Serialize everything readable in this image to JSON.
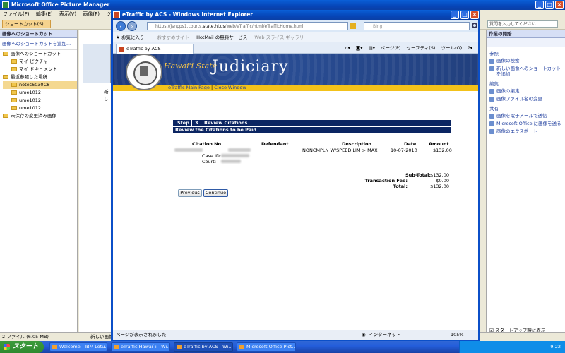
{
  "pm": {
    "title": "Microsoft Office Picture Manager",
    "menu": [
      "ファイル(F)",
      "編集(E)",
      "表示(V)",
      "画像(P)",
      "ツール("
    ],
    "toolbar_shortcut": "ショートカット(S)...",
    "help_placeholder": "質問を入力してください",
    "left_header": "画像へのショートカット",
    "add_shortcut": "画像へのショートカットを追加...",
    "tree": [
      "画像へのショートカット",
      "マイ ピクチャ",
      "マイ ドキュメント",
      "最近参照した場所",
      "notes6030C8",
      "ume1012",
      "ume1012",
      "ume1012",
      "未保存の変更済み画像"
    ],
    "status_left": "2 ファイル (6.05 MB)",
    "status_mid": "新しい画像",
    "thumb_label": "新し",
    "right_header": "作業の開始",
    "sections": {
      "browse": "参照",
      "edit": "編集",
      "share": "共有"
    },
    "links": {
      "find": "画像の検索",
      "new_shortcut": "新しい画像へのショートカットを追加",
      "edit_pictures": "画像の編集",
      "rename": "画像ファイル名の変更",
      "email": "画像を電子メールで送信",
      "send_office": "Microsoft Office に画像を送る",
      "export": "画像のエクスポート"
    },
    "startup_checkbox": "スタートアップ時に表示"
  },
  "ie": {
    "title": "eTraffic by ACS - Windows Internet Explorer",
    "url_prefix": "https://jsnpps1.courts.",
    "url_host": "state.hi.us",
    "url_suffix": "/web/eTraffic/html/eTrafficHome.html",
    "search_placeholder": "Bing",
    "favorites": "お気に入り",
    "fav1": "おすすめサイト",
    "fav2": "HotMail の無料サービス",
    "fav3": "Web スライス ギャラリー",
    "tab": "eTraffic by ACS",
    "tools": [
      "ページ(P)",
      "セーフティ(S)",
      "ツール(O)"
    ],
    "status": "ページが表示されました",
    "zone": "インターネット",
    "zoom": "105%"
  },
  "site": {
    "state": "Hawai'i State",
    "judiciary": "Judiciary",
    "nav_main": "eTraffic Main Page",
    "nav_sep": "|",
    "nav_close": "Close Window",
    "step_label": "Step",
    "step_num": "3",
    "step_title": "Review Citations",
    "review_bar": "Review the Citations to be Paid",
    "cols": {
      "citation": "Citation No",
      "defendant": "Defendant",
      "description": "Description",
      "date": "Date",
      "amount": "Amount"
    },
    "row": {
      "description": "NONCMPLN W/SPEED LIM > MAX",
      "date": "10-07-2010",
      "amount": "$132.00",
      "case_label": "Case ID:",
      "court_label": "Court:"
    },
    "totals": {
      "subtotal_label": "Sub-Total:",
      "subtotal": "$132.00",
      "fee_label": "Transaction Fee:",
      "fee": "$0.00",
      "total_label": "Total:",
      "total": "$132.00"
    },
    "previous": "Previous",
    "continue": "Continue"
  },
  "taskbar": {
    "start": "スタート",
    "items": [
      "Welcome - IBM Lotu...",
      "eTraffic Hawai`i - Wi...",
      "eTraffic by ACS - Wi...",
      "Microsoft Office Pict..."
    ],
    "clock": "9:22"
  }
}
